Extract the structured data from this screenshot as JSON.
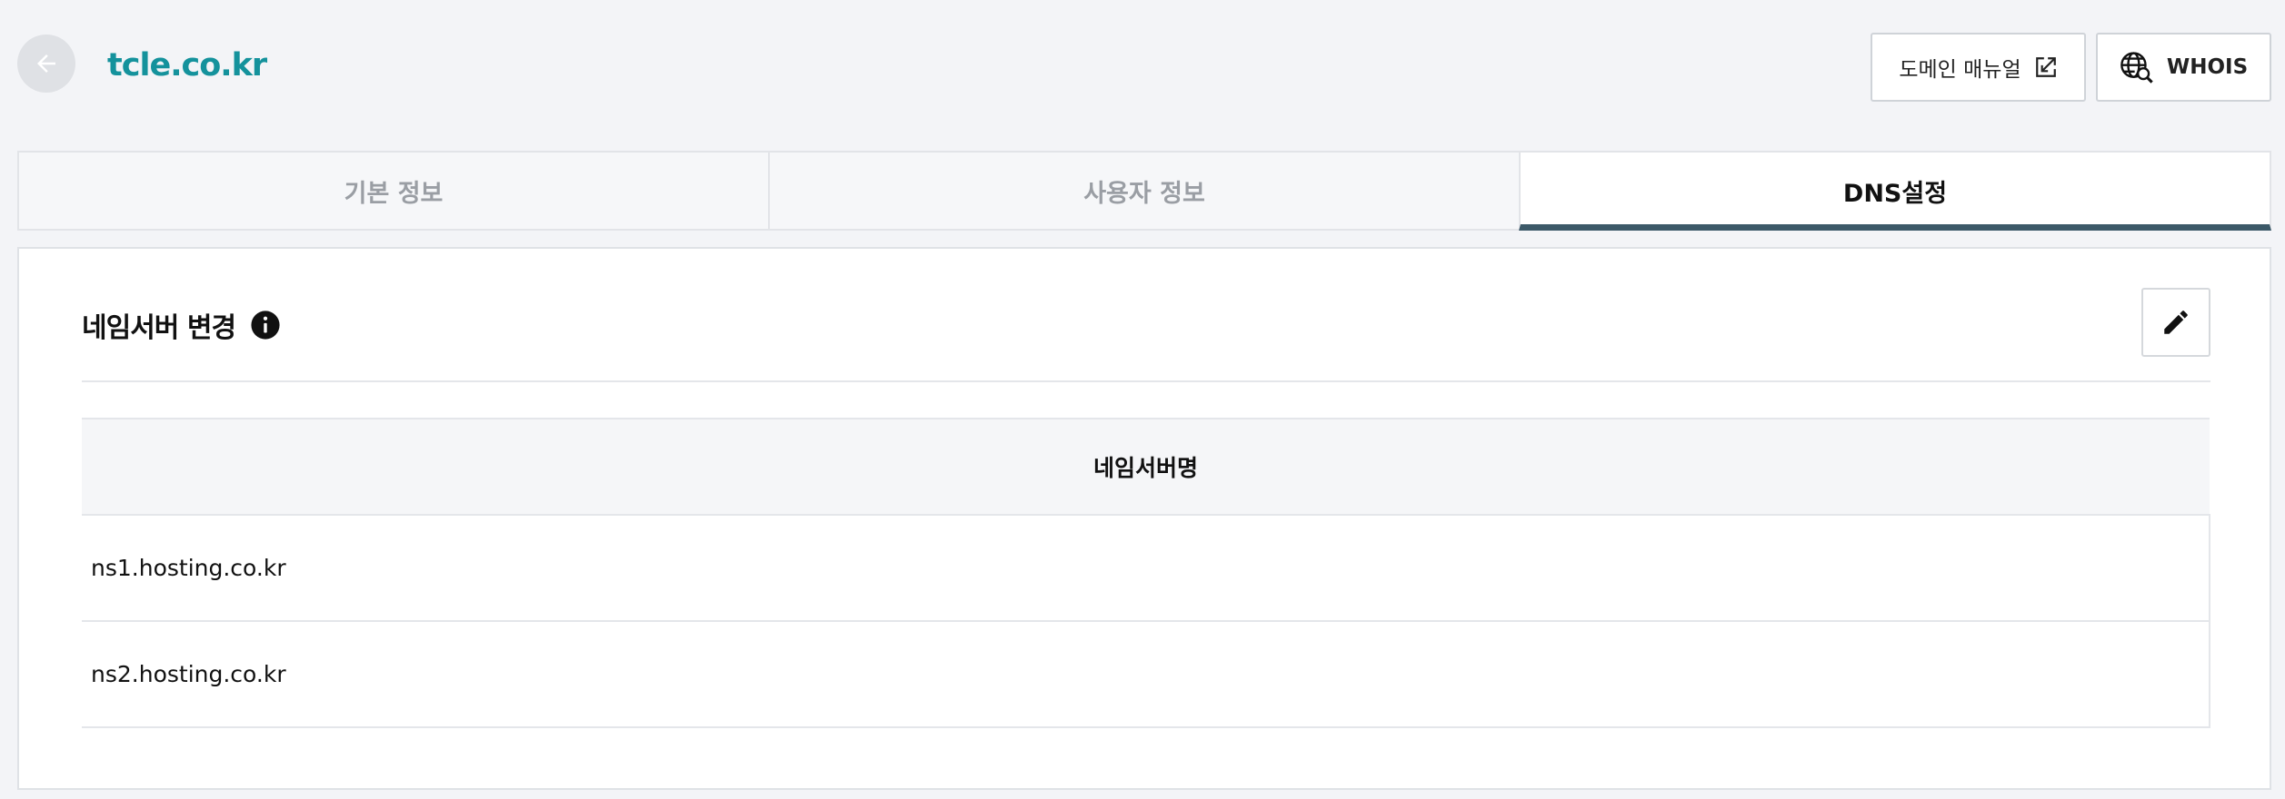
{
  "header": {
    "back_icon": "arrow-left-icon",
    "domain_name": "tcle.co.kr",
    "manual_button": {
      "label": "도메인 매뉴얼",
      "icon": "external-link-icon"
    },
    "whois_button": {
      "label": "WHOIS",
      "icon": "globe-search-icon"
    }
  },
  "tabs": [
    {
      "label": "기본 정보",
      "active": false
    },
    {
      "label": "사용자 정보",
      "active": false
    },
    {
      "label": "DNS설정",
      "active": true
    }
  ],
  "nameserver_section": {
    "title": "네임서버 변경",
    "info_icon": "info-icon",
    "edit_icon": "pencil-icon",
    "table": {
      "column_header": "네임서버명",
      "rows": [
        "ns1.hosting.co.kr",
        "ns2.hosting.co.kr"
      ]
    }
  },
  "colors": {
    "accent": "#14929c",
    "active_tab_underline": "#3c5968",
    "background": "#f3f4f7"
  }
}
